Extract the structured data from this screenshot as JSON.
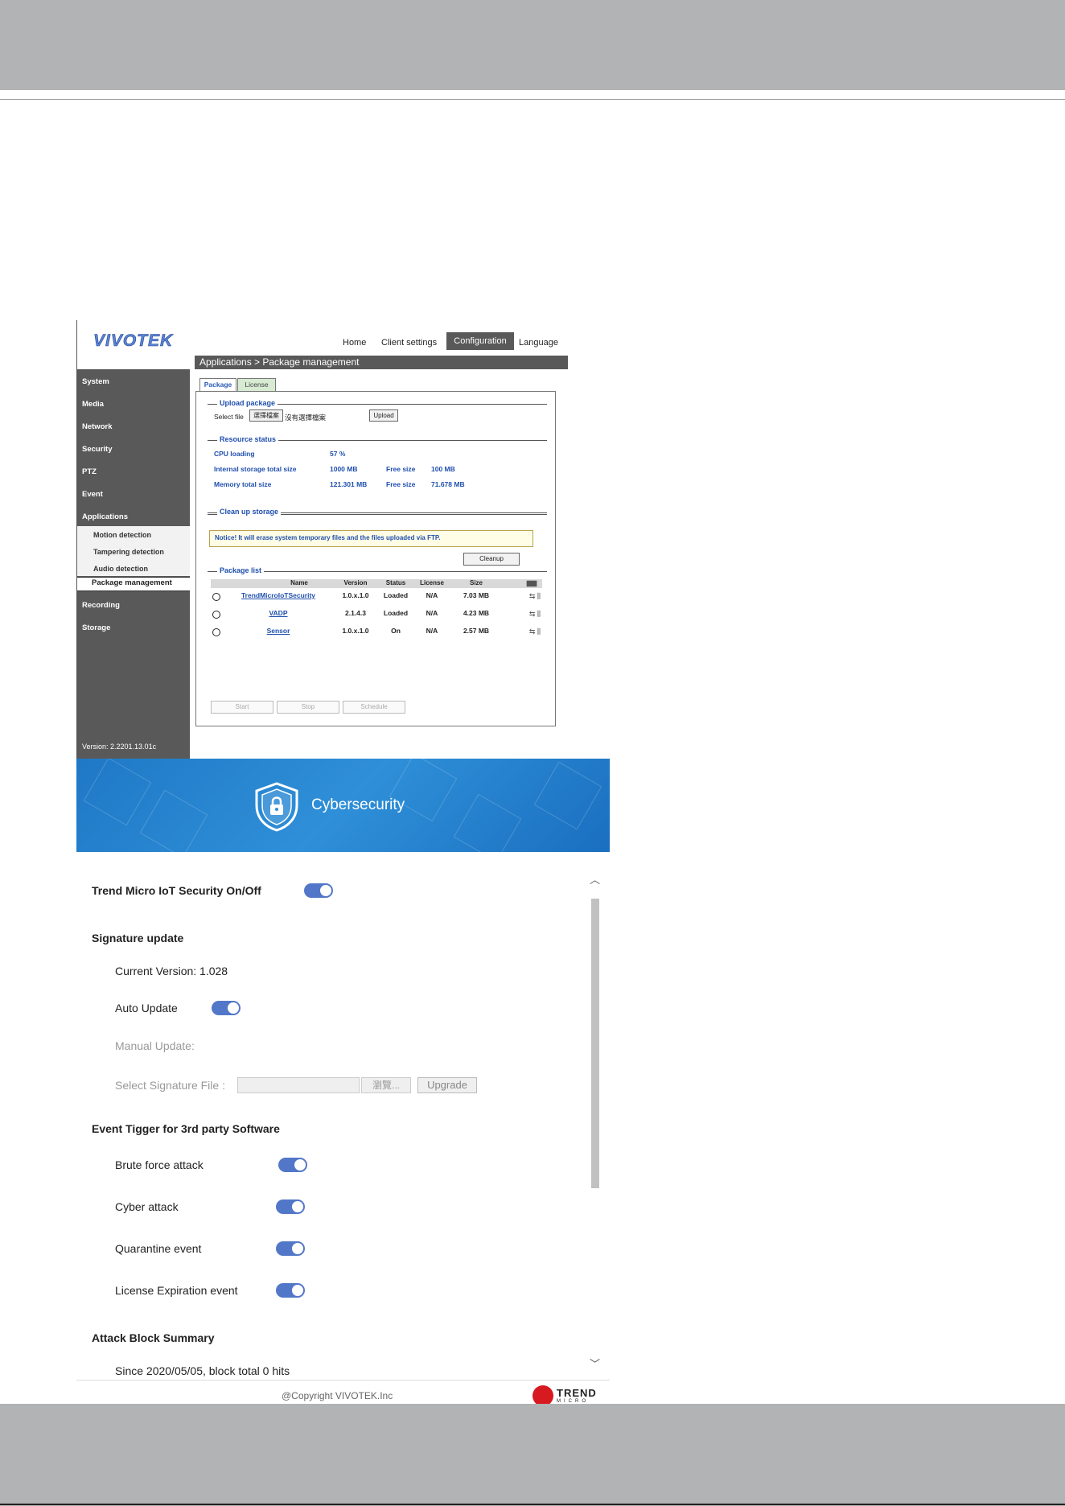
{
  "web_ui": {
    "logo": "VIVOTEK",
    "nav": {
      "home": "Home",
      "client_settings": "Client settings",
      "configuration": "Configuration",
      "language": "Language"
    },
    "breadcrumb": "Applications > Package management",
    "sidebar": {
      "items": [
        "System",
        "Media",
        "Network",
        "Security",
        "PTZ",
        "Event",
        "Applications"
      ],
      "sub_items": [
        "Motion detection",
        "Tampering detection",
        "Audio detection"
      ],
      "active": "Package management",
      "items_after": [
        "Recording",
        "Storage"
      ],
      "version": "Version: 2.2201.13.01c"
    },
    "tabs": {
      "package": "Package",
      "license": "License"
    },
    "upload": {
      "title": "Upload package",
      "label": "Select file",
      "choose_button": "選擇檔案",
      "no_file": "沒有選擇檔案",
      "upload_button": "Upload"
    },
    "resource": {
      "title": "Resource status",
      "cpu_label": "CPU loading",
      "cpu_value": "57 %",
      "mem_label": "Internal storage total size",
      "mem_value": "1000 MB",
      "free_label": "Free size",
      "free_value": "100 MB",
      "mem2_label": "Memory total size",
      "mem2_value": "121.301 MB",
      "free2_label": "Free size",
      "free2_value": "71.678 MB"
    },
    "cleanup": {
      "title": "Clean up storage",
      "notice": "Notice! It will erase system temporary files and the files uploaded via FTP.",
      "button": "Cleanup"
    },
    "package_list": {
      "title": "Package list",
      "headers": [
        "Name",
        "Version",
        "Status",
        "License",
        "Size"
      ],
      "rows": [
        {
          "name": "TrendMicroIoTSecurity",
          "version": "1.0.x.1.0",
          "status": "Loaded",
          "license": "N/A",
          "size": "7.03 MB"
        },
        {
          "name": "VADP",
          "version": "2.1.4.3",
          "status": "Loaded",
          "license": "N/A",
          "size": "4.23 MB"
        },
        {
          "name": "Sensor",
          "version": "1.0.x.1.0",
          "status": "On",
          "license": "N/A",
          "size": "2.57 MB"
        }
      ],
      "buttons": {
        "start": "Start",
        "stop": "Stop",
        "schedule": "Schedule"
      }
    }
  },
  "banner": {
    "title": "Cybersecurity"
  },
  "settings": {
    "security_toggle_label": "Trend Micro IoT Security On/Off",
    "signature_heading": "Signature update",
    "current_version": "Current Version: 1.028",
    "auto_update_label": "Auto Update",
    "manual_update_label": "Manual Update:",
    "select_file_label": "Select Signature File :",
    "browse_button": "瀏覽...",
    "upgrade_button": "Upgrade",
    "event_heading": "Event Tigger for 3rd party Software",
    "events": [
      "Brute force attack",
      "Cyber attack",
      "Quarantine event",
      "License Expiration event"
    ],
    "summary_heading": "Attack Block Summary",
    "summary_text": "Since 2020/05/05, block total 0 hits",
    "toggles_on": true
  },
  "footer": {
    "copyright": "@Copyright VIVOTEK.Inc",
    "brand_line1": "TREND",
    "brand_line2": "MICRO"
  },
  "colors": {
    "toggle": "#5277c8",
    "banner": "#2f8fd8",
    "sidebar": "#595959",
    "band": "#b2b3b5",
    "trend_red": "#d71920"
  }
}
